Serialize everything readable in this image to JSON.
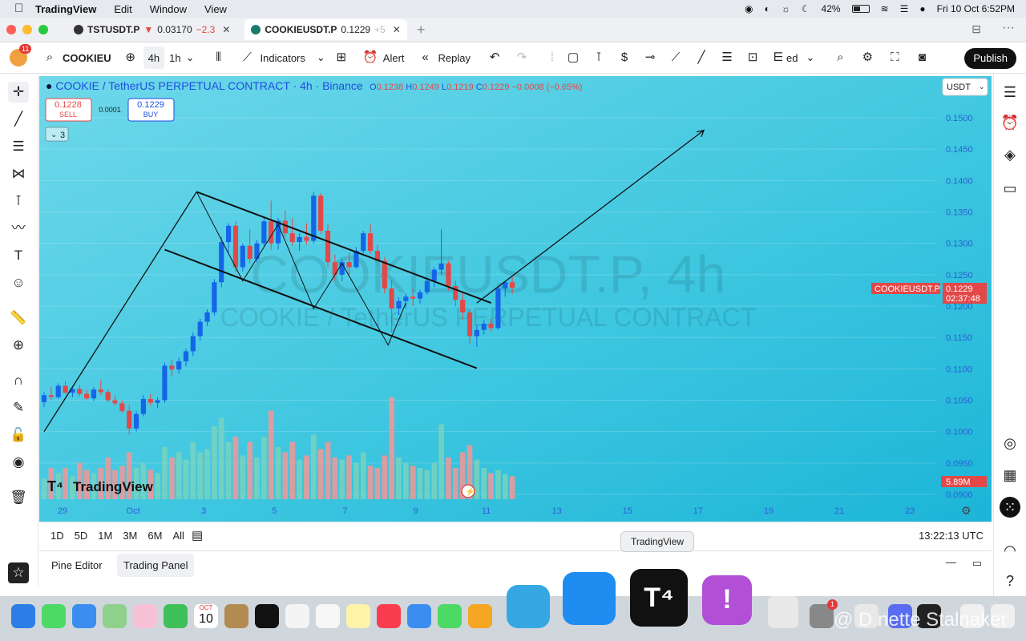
{
  "menubar": {
    "app": "TradingView",
    "items": [
      "Edit",
      "Window",
      "View"
    ],
    "battery": "42%",
    "datetime": "Fri 10 Oct  6:52PM"
  },
  "tabs": [
    {
      "symbol": "TSTUSDT.P",
      "arrow": "▼",
      "price": "0.03170",
      "change": "−2.3"
    },
    {
      "symbol": "COOKIEUSDT.P",
      "price": "0.1229",
      "change": "+5"
    }
  ],
  "toolbar": {
    "badge": "11",
    "symbol": "COOKIEU",
    "interval_active": "4h",
    "interval_alt": "1h",
    "indicators": "Indicators",
    "alert": "Alert",
    "replay": "Replay",
    "unnamed": "ed",
    "publish": "Publish"
  },
  "legend": {
    "title": "COOKIE / TetherUS PERPETUAL CONTRACT · 4h · Binance",
    "o_label": "O",
    "o": "0.1238",
    "h_label": "H",
    "h": "0.1249",
    "l_label": "L",
    "l": "0.1219",
    "c_label": "C",
    "c": "0.1229",
    "change": "−0.0008 (−0.65%)",
    "sell_price": "0.1228",
    "sell": "SELL",
    "spread": "0.0001",
    "buy_price": "0.1229",
    "buy": "BUY",
    "indicators_count": "3"
  },
  "watermark": {
    "line1": "COOKIEUSDT.P, 4h",
    "line2": "COOKIE / TetherUS PERPETUAL CONTRACT"
  },
  "currency": "USDT",
  "price_label": {
    "symbol": "COOKIEUSDT.P",
    "price": "0.1229",
    "countdown": "02:37:48"
  },
  "volume_label": "5.89M",
  "logo": "TradingView",
  "chart_data": {
    "type": "candlestick",
    "yaxis_ticks": [
      "0.1500",
      "0.1450",
      "0.1400",
      "0.1350",
      "0.1300",
      "0.1250",
      "0.1200",
      "0.1150",
      "0.1100",
      "0.1050",
      "0.1000",
      "0.0950",
      "0.0900"
    ],
    "xaxis_ticks": [
      "29",
      "Oct",
      "3",
      "5",
      "7",
      "9",
      "11",
      "13",
      "15",
      "17",
      "19",
      "21",
      "23"
    ],
    "ohlc": [
      [
        0.1047,
        0.1063,
        0.1039,
        0.1058
      ],
      [
        0.1058,
        0.1071,
        0.105,
        0.1055
      ],
      [
        0.1055,
        0.1077,
        0.1052,
        0.1073
      ],
      [
        0.1073,
        0.1081,
        0.106,
        0.1062
      ],
      [
        0.1062,
        0.1072,
        0.1055,
        0.1068
      ],
      [
        0.1068,
        0.1074,
        0.1056,
        0.106
      ],
      [
        0.106,
        0.1066,
        0.105,
        0.1053
      ],
      [
        0.1053,
        0.1071,
        0.1049,
        0.1067
      ],
      [
        0.1067,
        0.1082,
        0.1058,
        0.1063
      ],
      [
        0.1063,
        0.1067,
        0.1047,
        0.105
      ],
      [
        0.105,
        0.1058,
        0.1041,
        0.1045
      ],
      [
        0.1045,
        0.105,
        0.103,
        0.1033
      ],
      [
        0.1033,
        0.1043,
        0.0995,
        0.1005
      ],
      [
        0.1005,
        0.1033,
        0.1,
        0.1028
      ],
      [
        0.1028,
        0.1058,
        0.1024,
        0.1052
      ],
      [
        0.1052,
        0.106,
        0.1041,
        0.1046
      ],
      [
        0.1046,
        0.1055,
        0.1038,
        0.105
      ],
      [
        0.105,
        0.111,
        0.1046,
        0.1105
      ],
      [
        0.1105,
        0.1115,
        0.1088,
        0.1099
      ],
      [
        0.1099,
        0.1118,
        0.1092,
        0.1112
      ],
      [
        0.1112,
        0.1132,
        0.1104,
        0.1128
      ],
      [
        0.1128,
        0.1158,
        0.112,
        0.1152
      ],
      [
        0.1152,
        0.118,
        0.1145,
        0.1175
      ],
      [
        0.1175,
        0.1195,
        0.1168,
        0.119
      ],
      [
        0.119,
        0.1243,
        0.1185,
        0.1238
      ],
      [
        0.1238,
        0.131,
        0.123,
        0.1302
      ],
      [
        0.1302,
        0.1332,
        0.1285,
        0.1328
      ],
      [
        0.1328,
        0.1335,
        0.1254,
        0.1262
      ],
      [
        0.1262,
        0.13,
        0.1255,
        0.1296
      ],
      [
        0.1296,
        0.1322,
        0.1268,
        0.1275
      ],
      [
        0.1275,
        0.1305,
        0.127,
        0.13
      ],
      [
        0.13,
        0.134,
        0.1295,
        0.1335
      ],
      [
        0.1335,
        0.1368,
        0.129,
        0.13
      ],
      [
        0.13,
        0.134,
        0.129,
        0.1336
      ],
      [
        0.1336,
        0.1352,
        0.131,
        0.1316
      ],
      [
        0.1316,
        0.134,
        0.1296,
        0.1302
      ],
      [
        0.1302,
        0.1316,
        0.1288,
        0.131
      ],
      [
        0.131,
        0.1332,
        0.1298,
        0.1304
      ],
      [
        0.1304,
        0.1382,
        0.13,
        0.1376
      ],
      [
        0.1376,
        0.138,
        0.1315,
        0.132
      ],
      [
        0.132,
        0.133,
        0.1262,
        0.127
      ],
      [
        0.127,
        0.1282,
        0.124,
        0.125
      ],
      [
        0.125,
        0.1275,
        0.124,
        0.127
      ],
      [
        0.127,
        0.1285,
        0.125,
        0.1262
      ],
      [
        0.1262,
        0.1294,
        0.126,
        0.1288
      ],
      [
        0.1288,
        0.132,
        0.1284,
        0.1316
      ],
      [
        0.1316,
        0.133,
        0.1283,
        0.1288
      ],
      [
        0.1288,
        0.1298,
        0.1265,
        0.1272
      ],
      [
        0.1272,
        0.1278,
        0.122,
        0.1228
      ],
      [
        0.1228,
        0.1242,
        0.1158,
        0.1196
      ],
      [
        0.1196,
        0.1214,
        0.1186,
        0.1208
      ],
      [
        0.1208,
        0.122,
        0.1196,
        0.1215
      ],
      [
        0.1215,
        0.1228,
        0.12,
        0.1212
      ],
      [
        0.1212,
        0.1226,
        0.1204,
        0.1222
      ],
      [
        0.1222,
        0.1245,
        0.1218,
        0.124
      ],
      [
        0.124,
        0.1262,
        0.123,
        0.1258
      ],
      [
        0.1258,
        0.1322,
        0.125,
        0.1268
      ],
      [
        0.1268,
        0.1272,
        0.1225,
        0.1232
      ],
      [
        0.1232,
        0.124,
        0.12,
        0.121
      ],
      [
        0.121,
        0.1222,
        0.1178,
        0.119
      ],
      [
        0.119,
        0.1195,
        0.114,
        0.1152
      ],
      [
        0.1152,
        0.117,
        0.1135,
        0.1162
      ],
      [
        0.1162,
        0.1178,
        0.1155,
        0.1172
      ],
      [
        0.1172,
        0.118,
        0.116,
        0.1165
      ],
      [
        0.1165,
        0.1232,
        0.1162,
        0.1228
      ],
      [
        0.1228,
        0.124,
        0.1215,
        0.1238
      ],
      [
        0.1238,
        0.1249,
        0.1219,
        0.1229
      ]
    ],
    "volume_rel": [
      0.2,
      0.3,
      0.25,
      0.3,
      0.22,
      0.35,
      0.28,
      0.25,
      0.3,
      0.4,
      0.28,
      0.32,
      0.45,
      0.3,
      0.35,
      0.28,
      0.25,
      0.5,
      0.4,
      0.45,
      0.38,
      0.55,
      0.45,
      0.48,
      0.7,
      0.78,
      0.55,
      0.6,
      0.42,
      0.55,
      0.4,
      0.6,
      0.85,
      0.5,
      0.45,
      0.55,
      0.38,
      0.42,
      0.62,
      0.48,
      0.55,
      0.4,
      0.38,
      0.42,
      0.35,
      0.45,
      0.32,
      0.3,
      0.42,
      0.98,
      0.4,
      0.35,
      0.32,
      0.3,
      0.28,
      0.35,
      0.72,
      0.4,
      0.3,
      0.45,
      0.52,
      0.38,
      0.3,
      0.25,
      0.28,
      0.24,
      0.22
    ],
    "trendlines": [
      {
        "from": [
          0,
          0.1
        ],
        "to": [
          21.5,
          0.1382
        ],
        "label": ""
      },
      {
        "from": [
          21.5,
          0.1382
        ],
        "to": [
          63,
          0.1205
        ],
        "label": ""
      },
      {
        "from": [
          17,
          0.129
        ],
        "to": [
          61,
          0.1101
        ],
        "label": ""
      },
      {
        "from": [
          61,
          0.1205
        ],
        "to": [
          93,
          0.148
        ],
        "label": ""
      }
    ],
    "zigzag": [
      [
        21.5,
        0.1382
      ],
      [
        28,
        0.124
      ],
      [
        33,
        0.133
      ],
      [
        38,
        0.1196
      ],
      [
        42,
        0.1268
      ],
      [
        48.5,
        0.1138
      ],
      [
        51,
        0.1205
      ]
    ]
  },
  "bottombar": {
    "ranges": [
      "1D",
      "5D",
      "1M",
      "3M",
      "6M",
      "All"
    ],
    "clock": "13:22:13 UTC"
  },
  "panel": {
    "tabs": [
      "Pine Editor",
      "Trading Panel"
    ]
  },
  "tooltip": "TradingView",
  "dock_calendar": {
    "month": "OCT",
    "day": "10"
  },
  "dock_badge": "1",
  "overlay_watermark": "@ D  nette Stalnaker"
}
